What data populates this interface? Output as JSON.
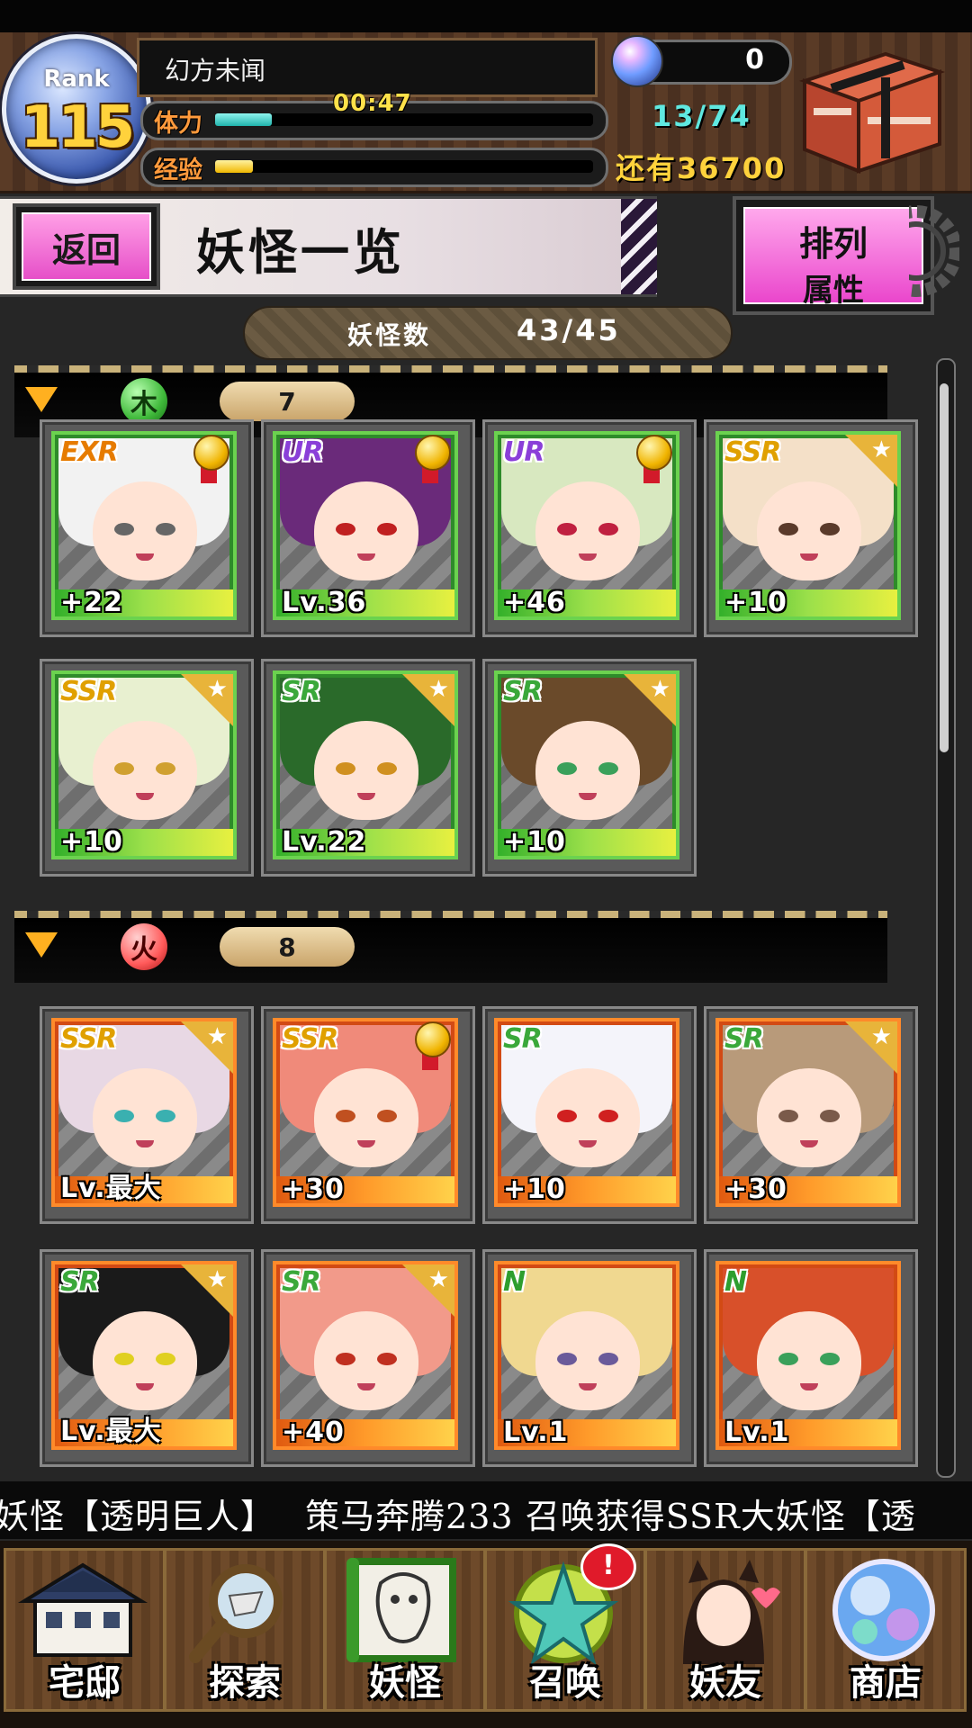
{
  "header": {
    "rank_label": "Rank",
    "rank_value": "115",
    "player_name": "幻方未闻",
    "stamina_label": "体力",
    "stamina_fill_fraction": 0.15,
    "stamina_timer": "00:47",
    "stamina_count": "13/74",
    "exp_label": "经验",
    "exp_fill_fraction": 0.1,
    "next_exp_text": "还有36700",
    "orb_count": "0"
  },
  "title_row": {
    "back_label": "返回",
    "page_title": "妖怪一览",
    "sort_line1": "排列",
    "sort_line2": "属性"
  },
  "monster_count": {
    "label": "妖怪数",
    "value": "43/45"
  },
  "groups": [
    {
      "attribute": "木",
      "count": "7",
      "cards": [
        {
          "rarity": "EXR",
          "level_text": "+22",
          "badge": "medal"
        },
        {
          "rarity": "UR",
          "level_text": "Lv.36",
          "badge": "medal"
        },
        {
          "rarity": "UR",
          "level_text": "+46",
          "badge": "medal"
        },
        {
          "rarity": "SSR",
          "level_text": "+10",
          "badge": "star"
        },
        {
          "rarity": "SSR",
          "level_text": "+10",
          "badge": "star"
        },
        {
          "rarity": "SR",
          "level_text": "Lv.22",
          "badge": "star"
        },
        {
          "rarity": "SR",
          "level_text": "+10",
          "badge": "star"
        }
      ]
    },
    {
      "attribute": "火",
      "count": "8",
      "cards": [
        {
          "rarity": "SSR",
          "level_text": "Lv.最大",
          "badge": "star"
        },
        {
          "rarity": "SSR",
          "level_text": "+30",
          "badge": "medal"
        },
        {
          "rarity": "SR",
          "level_text": "+10",
          "badge": "none"
        },
        {
          "rarity": "SR",
          "level_text": "+30",
          "badge": "star"
        },
        {
          "rarity": "SR",
          "level_text": "Lv.最大",
          "badge": "star"
        },
        {
          "rarity": "SR",
          "level_text": "+40",
          "badge": "star"
        },
        {
          "rarity": "N",
          "level_text": "Lv.1",
          "badge": "none"
        },
        {
          "rarity": "N",
          "level_text": "Lv.1",
          "badge": "none"
        }
      ]
    }
  ],
  "ticker": {
    "text": "妖怪【透明巨人】　 策马奔腾233 召唤获得SSR大妖怪【透"
  },
  "nav": [
    {
      "label": "宅邸",
      "icon": "house-icon"
    },
    {
      "label": "探索",
      "icon": "magnifier-icon"
    },
    {
      "label": "妖怪",
      "icon": "scroll-icon"
    },
    {
      "label": "召唤",
      "icon": "pentagram-icon",
      "badge": "!"
    },
    {
      "label": "妖友",
      "icon": "catgirl-icon"
    },
    {
      "label": "商店",
      "icon": "crystal-orb-icon"
    }
  ]
}
